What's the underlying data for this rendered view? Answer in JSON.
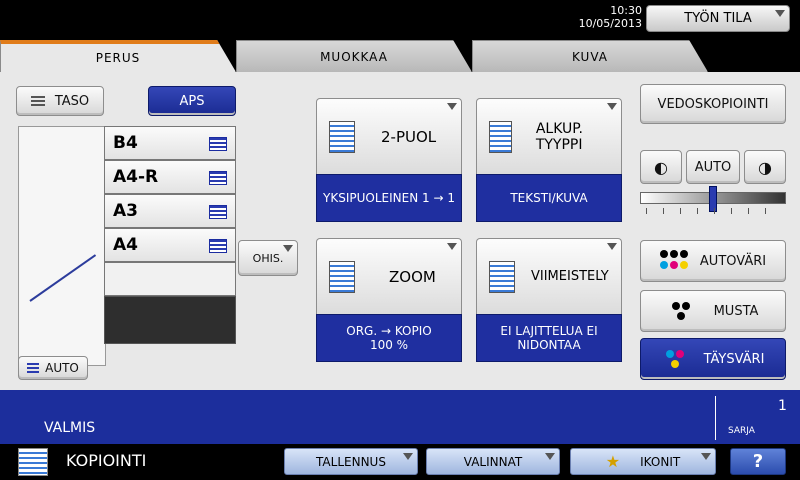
{
  "header": {
    "time": "10:30",
    "date": "10/05/2013",
    "status_button": "TYÖN TILA"
  },
  "tabs": [
    "PERUS",
    "MUOKKAA",
    "KUVA"
  ],
  "left": {
    "taso_button": "TASO",
    "aps_button": "APS",
    "trays": [
      "B4",
      "A4-R",
      "A3",
      "A4",
      ""
    ],
    "auto_label": "AUTO",
    "ohis_button": "OHIS."
  },
  "functions": {
    "duplex_label": "2-PUOL",
    "duplex_value": "YKSIPUOLEINEN 1 → 1",
    "original_type_label": "ALKUP. TYYPPI",
    "original_type_value": "TEKSTI/KUVA",
    "zoom_label": "ZOOM",
    "zoom_value_line1": "ORG. → KOPIO",
    "zoom_value_line2": "100 %",
    "finishing_label": "VIIMEISTELY",
    "finishing_value_line1": "EI LAJITTELUA EI",
    "finishing_value_line2": "NIDONTAA"
  },
  "right": {
    "proof_copy_button": "VEDOSKOPIOINTI",
    "density_auto": "AUTO",
    "density_level": 0.5,
    "color_buttons": [
      "AUTOVÄRI",
      "MUSTA",
      "TÄYSVÄRI"
    ]
  },
  "status": {
    "message": "VALMIS",
    "sarja_label": "SARJA",
    "sarja_value": "1"
  },
  "bottom": {
    "mode_label": "KOPIOINTI",
    "tallennus": "TALLENNUS",
    "valinnat": "VALINNAT",
    "ikonit": "IKONIT",
    "help": "?"
  }
}
